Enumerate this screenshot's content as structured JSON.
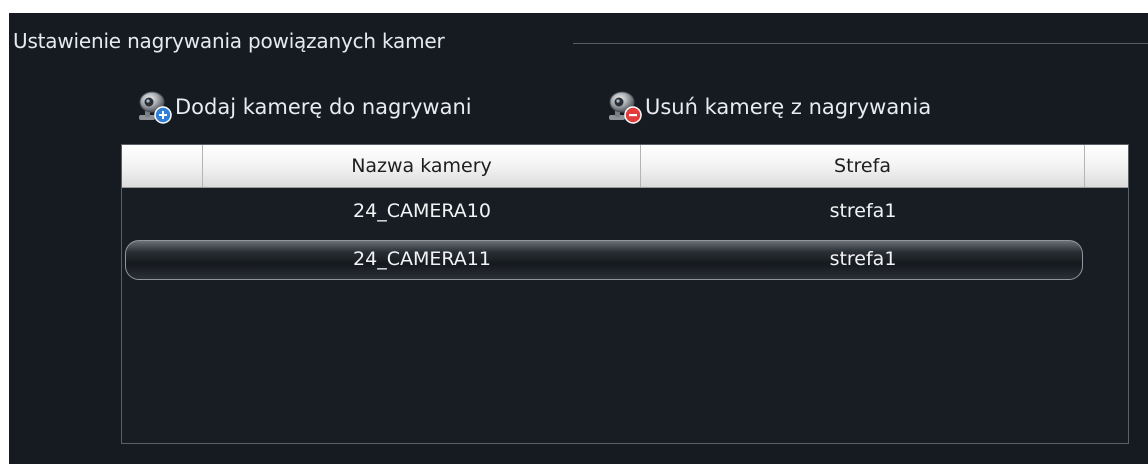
{
  "group": {
    "title": "Ustawienie nagrywania powiązanych kamer"
  },
  "toolbar": {
    "add_label": "Dodaj  kamerę  do nagrywani",
    "add_icon": "add-camera-icon",
    "remove_label": "Usuń kamerę z nagrywania",
    "remove_icon": "remove-camera-icon"
  },
  "table": {
    "columns": [
      "",
      "Nazwa kamery",
      "Strefa",
      ""
    ],
    "rows": [
      {
        "name": "24_CAMERA10",
        "zone": "strefa1",
        "selected": false
      },
      {
        "name": "24_CAMERA11",
        "zone": "strefa1",
        "selected": true
      }
    ]
  },
  "colors": {
    "background": "#161b22",
    "text": "#e8ebef",
    "add_badge": "#2f7fd6",
    "remove_badge": "#e23b3b"
  }
}
